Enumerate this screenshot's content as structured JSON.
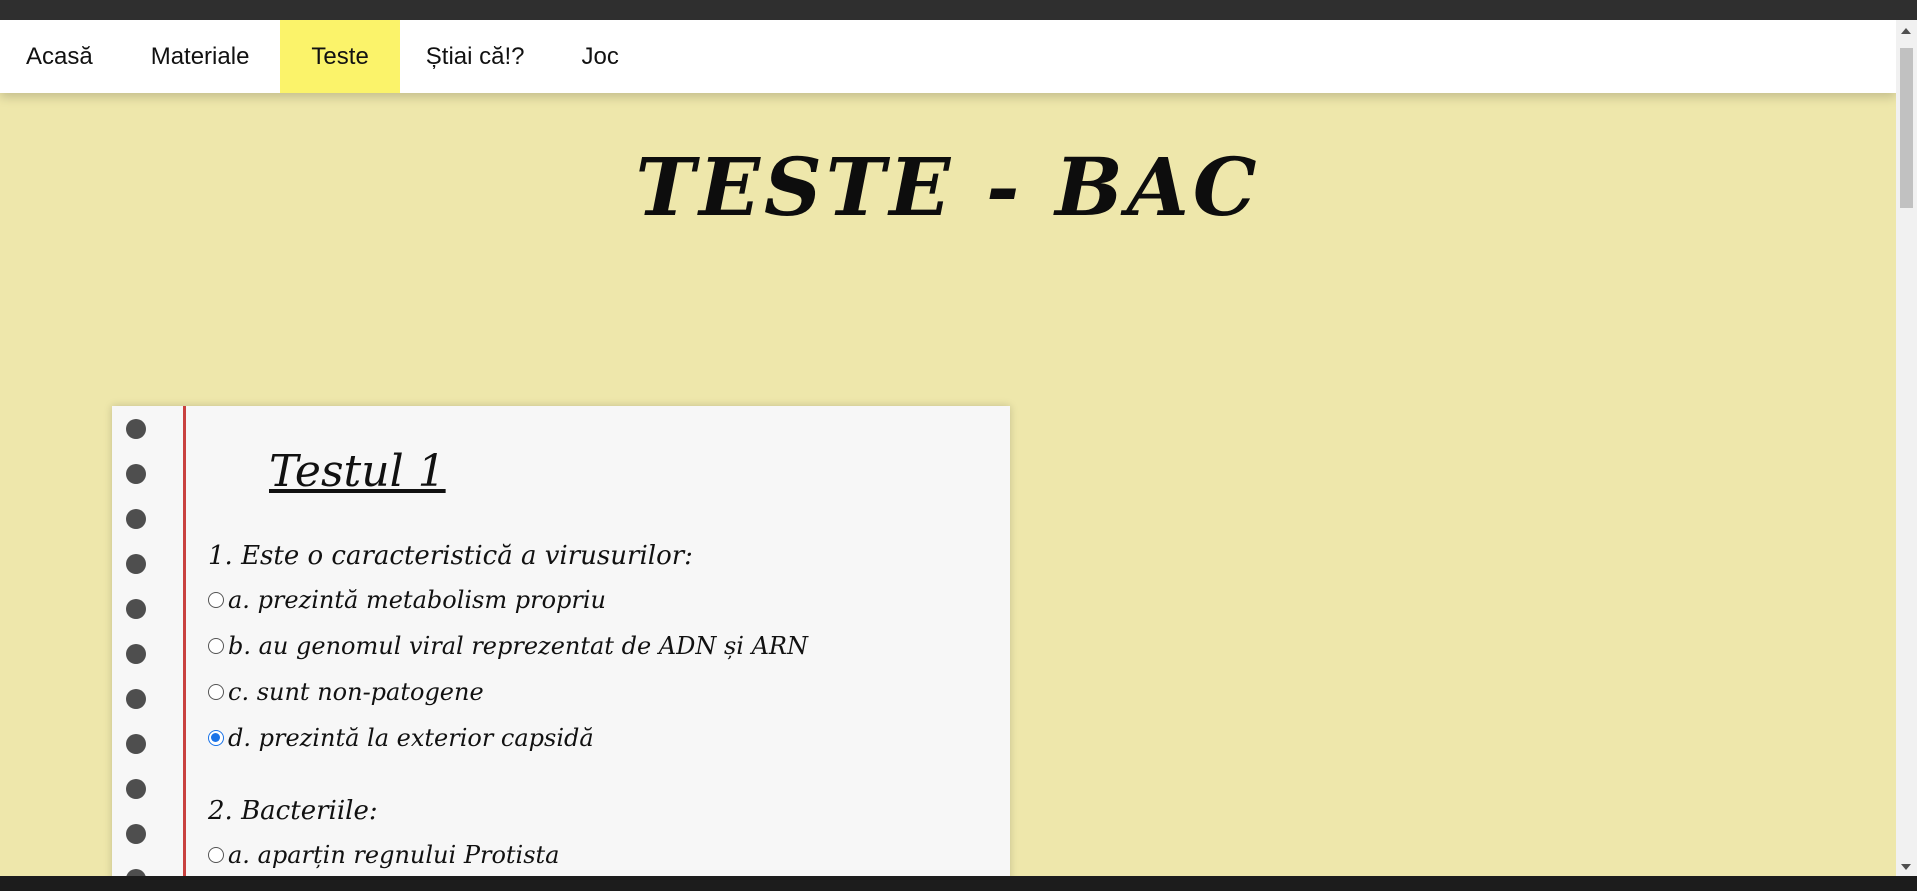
{
  "nav": {
    "items": [
      {
        "label": "Acasă",
        "active": false
      },
      {
        "label": "Materiale",
        "active": false
      },
      {
        "label": "Teste",
        "active": true
      },
      {
        "label": "Știai că!?",
        "active": false
      },
      {
        "label": "Joc",
        "active": false
      }
    ],
    "active_color": "#fbf36a"
  },
  "page": {
    "title": "TESTE - BAC",
    "background": "#eee7ab"
  },
  "test": {
    "title": "Testul 1",
    "q1": {
      "text": "1. Este o caracteristică a virusurilor:",
      "options": [
        {
          "label": "a. prezintă metabolism propriu",
          "checked": false
        },
        {
          "label": "b. au genomul viral reprezentat de ADN și ARN",
          "checked": false
        },
        {
          "label": "c. sunt non-patogene",
          "checked": false
        },
        {
          "label": "d. prezintă la exterior capsidă",
          "checked": true
        }
      ]
    },
    "q2": {
      "text": "2. Bacteriile:",
      "options": [
        {
          "label": "a. aparțin regnului Protista",
          "checked": false
        }
      ]
    }
  }
}
